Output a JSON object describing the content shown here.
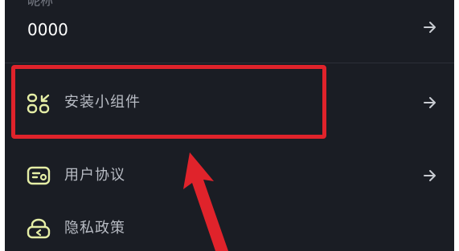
{
  "nickname": {
    "label": "昵称",
    "value": "0000"
  },
  "menu_items": [
    {
      "label": "安装小组件",
      "icon": "widget-icon"
    },
    {
      "label": "用户协议",
      "icon": "agreement-icon"
    },
    {
      "label": "隐私政策",
      "icon": "privacy-icon"
    }
  ],
  "colors": {
    "background": "#1a1d24",
    "accent": "#e5eea6",
    "highlight": "#e0232b"
  }
}
